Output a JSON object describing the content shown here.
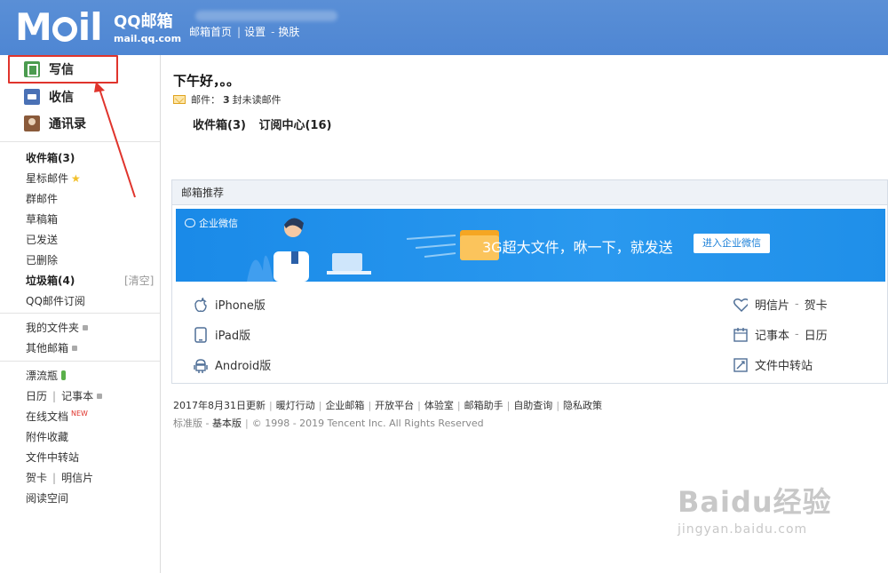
{
  "header": {
    "logo_text": "Mail",
    "brand": "QQ邮箱",
    "domain": "mail.qq.com",
    "links": [
      "邮箱首页",
      "设置",
      "换肤"
    ],
    "bg_color": "#4e86d3"
  },
  "sidebar": {
    "actions": [
      {
        "label": "写信",
        "icon": "compose-icon"
      },
      {
        "label": "收信",
        "icon": "inbox-icon"
      },
      {
        "label": "通讯录",
        "icon": "contacts-icon"
      }
    ],
    "folders": [
      {
        "label": "收件箱(3)"
      },
      {
        "label": "星标邮件"
      },
      {
        "label": "群邮件"
      },
      {
        "label": "草稿箱"
      },
      {
        "label": "已发送"
      },
      {
        "label": "已删除"
      },
      {
        "label": "垃圾箱(4)",
        "action": "[清空]"
      },
      {
        "label": "QQ邮件订阅"
      }
    ],
    "my_folders": [
      {
        "label": "我的文件夹"
      },
      {
        "label": "其他邮箱"
      }
    ],
    "apps": {
      "drift_bottle": "漂流瓶",
      "calendar": "日历",
      "notebook": "记事本",
      "online_docs": "在线文档",
      "new_badge": "NEW",
      "attachments": "附件收藏",
      "file_transfer": "文件中转站",
      "greeting_card": "贺卡",
      "postcard": "明信片",
      "reading": "阅读空间"
    }
  },
  "main": {
    "greeting": "下午好，。。",
    "unread_prefix": "邮件：",
    "unread_count": "3",
    "unread_suffix": "封未读邮件",
    "quick_links": [
      "收件箱(3)",
      "订阅中心(16)"
    ],
    "recommend": {
      "title": "邮箱推荐",
      "banner": {
        "label": "企业微信",
        "slogan": "3G超大文件，咻一下，就发送",
        "button": "进入企业微信",
        "bg_color": "#1a8ae8"
      },
      "left_items": [
        {
          "label": "iPhone版",
          "icon": "apple-icon"
        },
        {
          "label": "iPad版",
          "icon": "tablet-icon"
        },
        {
          "label": "Android版",
          "icon": "android-icon"
        }
      ],
      "right_items": [
        {
          "label": "明信片",
          "sub": "贺卡",
          "icon": "heart-icon"
        },
        {
          "label": "记事本",
          "sub": "日历",
          "icon": "calendar-icon"
        },
        {
          "label": "文件中转站",
          "sub": "",
          "icon": "file-transfer-icon"
        }
      ]
    },
    "footer": {
      "links": [
        "2017年8月31日更新",
        "暖灯行动",
        "企业邮箱",
        "开放平台",
        "体验室",
        "邮箱助手",
        "自助查询",
        "隐私政策"
      ],
      "edition": "标准版",
      "edition_sep": "-",
      "base_edition": "基本版",
      "copyright": "© 1998 - 2019 Tencent Inc. All Rights Reserved"
    }
  },
  "watermark": {
    "text": "Baidu经验",
    "url": "jingyan.baidu.com"
  }
}
